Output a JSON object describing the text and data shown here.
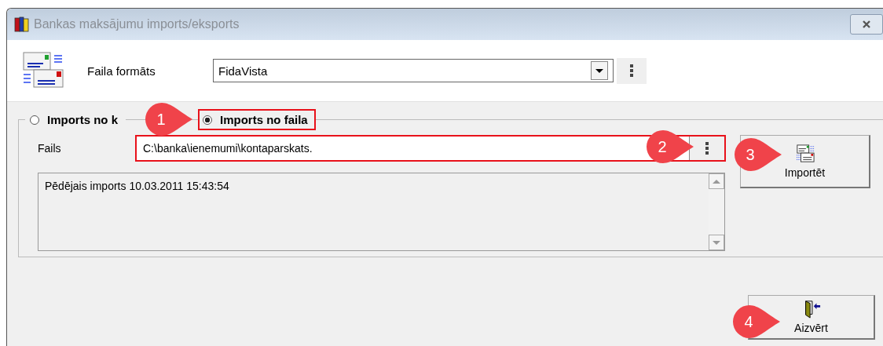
{
  "window": {
    "title": "Bankas maksājumu imports/eksports"
  },
  "header": {
    "label": "Faila formāts",
    "format_value": "FidaVista"
  },
  "source_options": [
    {
      "label": "Imports no k",
      "selected": false,
      "highlighted": false
    },
    {
      "label": "Imports no faila",
      "selected": true,
      "highlighted": true
    }
  ],
  "file": {
    "label": "Fails",
    "value": "C:\\banka\\ienemumi\\kontaparskats.",
    "highlighted": true
  },
  "log": {
    "text": "Pēdējais imports 10.03.2011 15:43:54"
  },
  "buttons": [
    {
      "kind": "import",
      "label": "Importēt"
    },
    {
      "kind": "close",
      "label": "Aizvērt"
    }
  ],
  "callouts": [
    {
      "number": "1"
    },
    {
      "number": "2"
    },
    {
      "number": "3"
    },
    {
      "number": "4"
    }
  ]
}
